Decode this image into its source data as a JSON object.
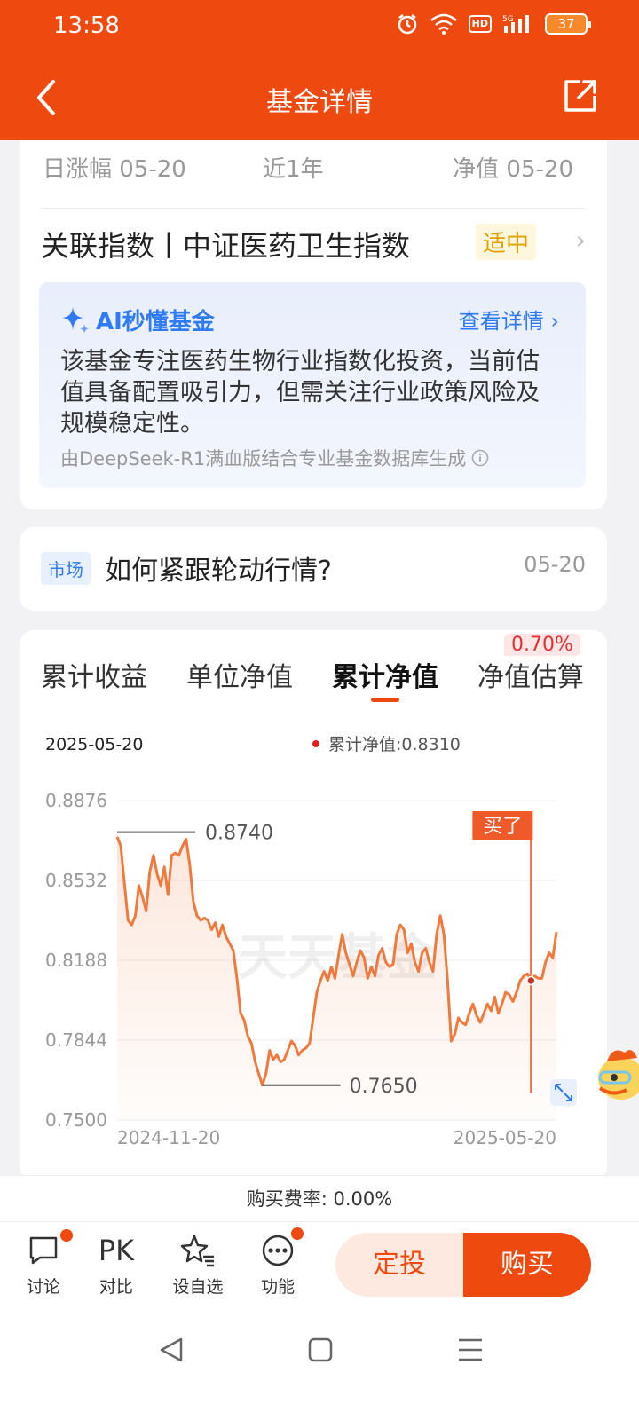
{
  "status_bar": {
    "time": "13:58",
    "battery": "37"
  },
  "nav": {
    "title": "基金详情"
  },
  "stats": {
    "labels": [
      "日涨幅 05-20",
      "近1年",
      "净值 05-20"
    ]
  },
  "related_index": {
    "label": "关联指数丨中证医药卫生指数",
    "tag": "适中"
  },
  "ai_summary": {
    "title": "AI秒懂基金",
    "link": "查看详情",
    "text": "该基金专注医药生物行业指数化投资，当前估值具备配置吸引力，但需关注行业政策风险及规模稳定性。",
    "note": "由DeepSeek-R1满血版结合专业基金数据库生成"
  },
  "market": {
    "tag": "市场",
    "title": "如何紧跟轮动行情?",
    "date": "05-20"
  },
  "tabs": {
    "items": [
      "累计收益",
      "单位净值",
      "累计净值",
      "净值估算"
    ],
    "active_index": 2,
    "badge": "0.70%"
  },
  "chart_header": {
    "date": "2025-05-20",
    "legend": "累计净值:0.8310"
  },
  "chart_data": {
    "type": "line",
    "yticks": [
      "0.8876",
      "0.8532",
      "0.8188",
      "0.7844",
      "0.7500"
    ],
    "ylim": [
      0.75,
      0.8876
    ],
    "xticks": [
      "2024-11-20",
      "2025-05-20"
    ],
    "max_label": "0.8740",
    "min_label": "0.7650",
    "buy_marker": "买了",
    "watermark": "天天基金",
    "series": [
      {
        "values": [
          0.872,
          0.868,
          0.852,
          0.836,
          0.834,
          0.838,
          0.851,
          0.846,
          0.84,
          0.857,
          0.864,
          0.856,
          0.851,
          0.859,
          0.847,
          0.864,
          0.865,
          0.864,
          0.868,
          0.871,
          0.86,
          0.844,
          0.838,
          0.836,
          0.837,
          0.836,
          0.832,
          0.835,
          0.829,
          0.834,
          0.829,
          0.826,
          0.823,
          0.811,
          0.796,
          0.793,
          0.786,
          0.783,
          0.775,
          0.77,
          0.765,
          0.77,
          0.78,
          0.776,
          0.778,
          0.775,
          0.776,
          0.78,
          0.784,
          0.782,
          0.778,
          0.78,
          0.781,
          0.783,
          0.794,
          0.805,
          0.81,
          0.814,
          0.81,
          0.816,
          0.811,
          0.821,
          0.83,
          0.822,
          0.817,
          0.812,
          0.818,
          0.823,
          0.82,
          0.811,
          0.816,
          0.812,
          0.821,
          0.824,
          0.818,
          0.816,
          0.817,
          0.83,
          0.834,
          0.832,
          0.822,
          0.826,
          0.818,
          0.814,
          0.822,
          0.824,
          0.818,
          0.814,
          0.83,
          0.838,
          0.83,
          0.81,
          0.784,
          0.787,
          0.794,
          0.792,
          0.791,
          0.796,
          0.8,
          0.795,
          0.792,
          0.796,
          0.8,
          0.797,
          0.803,
          0.796,
          0.8,
          0.805,
          0.804,
          0.801,
          0.805,
          0.81,
          0.812,
          0.813,
          0.81,
          0.812,
          0.811,
          0.811,
          0.818,
          0.822,
          0.82,
          0.831
        ]
      }
    ]
  },
  "fee": {
    "text": "购买费率: 0.00%"
  },
  "bottom": {
    "items": [
      "讨论",
      "对比",
      "设自选",
      "功能"
    ],
    "pk": "PK",
    "dingtou": "定投",
    "buy": "购买"
  },
  "colors": {
    "brand": "#ee4a10",
    "line": "#f07a3d",
    "ai_blue": "#2f7bf5"
  }
}
